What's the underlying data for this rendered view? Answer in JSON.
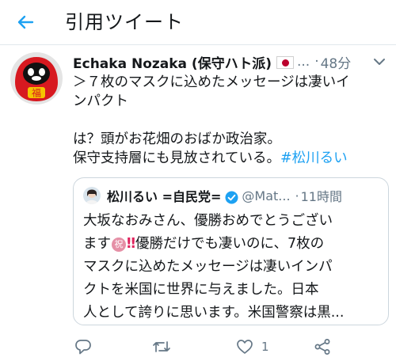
{
  "header": {
    "title": "引用ツイート"
  },
  "tweet": {
    "author_name": "Echaka Nozaka (保守ハト派)",
    "name_truncation": "...",
    "separator": "·",
    "time": "48分",
    "lines": [
      "＞７枚のマスクに込めたメッセージは凄いイ",
      "ンパクト",
      "",
      "は？頭がお花畑のおばか政治家。",
      "保守支持層にも見放されている。"
    ],
    "hashtag": "#松川るい",
    "avatar_glyph": "福"
  },
  "quote": {
    "author_name": "松川るい =自民党=",
    "handle": "@Mat...",
    "separator": "·",
    "time": "11時間",
    "line1": "大坂なおみさん、優勝おめでとうござい",
    "line2_pre": "ます",
    "emoji_iwai": "祝",
    "emoji_bang": "‼",
    "line2_post": "優勝だけでも凄いのに、7枚の",
    "line3": "マスクに込めたメッセージは凄いインパ",
    "line4": "クトを米国に世界に与えました。日本",
    "line5": "人として誇りに思います。米国警察は黒..."
  },
  "actions": {
    "like_count": "1"
  },
  "colors": {
    "accent": "#1da1f2",
    "text": "#14171a",
    "muted": "#657786",
    "border": "#ccd6dd"
  },
  "icons": {
    "back": "arrow-left-icon",
    "reply": "reply-icon",
    "retweet": "retweet-icon",
    "like": "heart-icon",
    "share": "share-icon",
    "verified": "verified-badge-icon",
    "flag": "japan-flag-icon",
    "caret": "chevron-down-icon"
  }
}
